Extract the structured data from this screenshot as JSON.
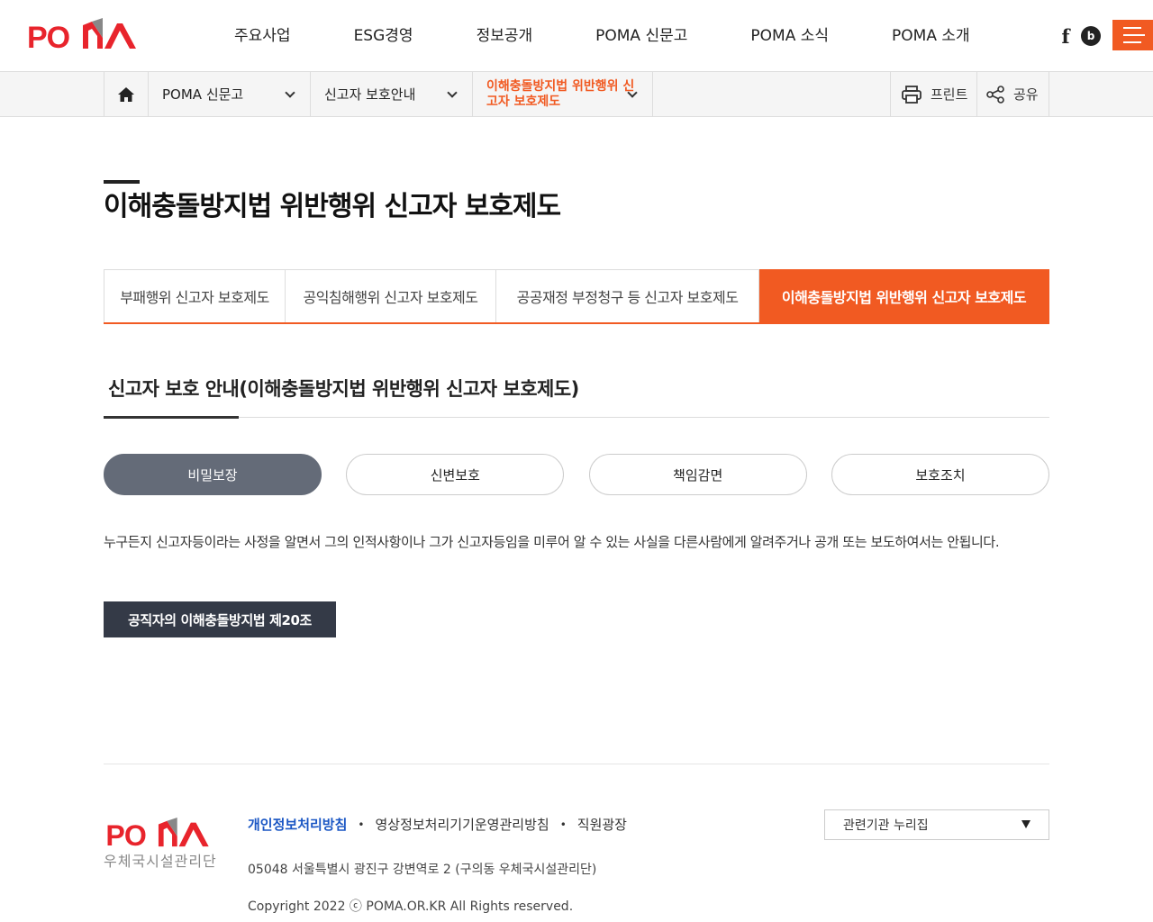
{
  "header": {
    "logo_text": "POMA",
    "nav": [
      "주요사업",
      "ESG경영",
      "정보공개",
      "POMA 신문고",
      "POMA 소식",
      "POMA 소개"
    ],
    "brand_color": "#f15a22",
    "sns": [
      {
        "name": "facebook-icon",
        "glyph": "f"
      },
      {
        "name": "blog-icon",
        "glyph": "b"
      }
    ]
  },
  "location": {
    "depth1": "POMA 신문고",
    "depth2": "신고자 보호안내",
    "depth3": "이해충돌방지법 위반행위 신고자 보호제도",
    "print_label": "프린트",
    "share_label": "공유"
  },
  "main": {
    "title": "이해충돌방지법 위반행위 신고자 보호제도",
    "tabs": [
      {
        "label": "부패행위 신고자 보호제도",
        "active": false
      },
      {
        "label": "공익침해행위 신고자 보호제도",
        "active": false
      },
      {
        "label": "공공재정 부정청구 등 신고자 보호제도",
        "active": false
      },
      {
        "label": "이해충돌방지법 위반행위 신고자 보호제도",
        "active": true
      }
    ],
    "subtitle": "신고자 보호 안내(이해충돌방지법 위반행위 신고자 보호제도)",
    "pills": [
      {
        "label": "비밀보장",
        "active": true
      },
      {
        "label": "신변보호",
        "active": false
      },
      {
        "label": "책임감면",
        "active": false
      },
      {
        "label": "보호조치",
        "active": false
      }
    ],
    "description": "누구든지 신고자등이라는 사정을 알면서 그의 인적사항이나 그가 신고자등임을 미루어 알 수 있는 사실을 다른사람에게 알려주거나 공개 또는 보도하여서는 안됩니다.",
    "law_button": "공직자의 이해충돌방지법 제20조"
  },
  "footer": {
    "logo_text": "POMA",
    "org_name": "우체국시설관리단",
    "links": [
      "개인정보처리방침",
      "영상정보처리기기운영관리방침",
      "직원광장"
    ],
    "address": "05048 서울특별시 광진구 강변역로 2 (구의동 우체국시설관리단)",
    "copyright": "Copyright 2022 ⓒ POMA.OR.KR All Rights reserved.",
    "related_select": "관련기관 누리집"
  }
}
